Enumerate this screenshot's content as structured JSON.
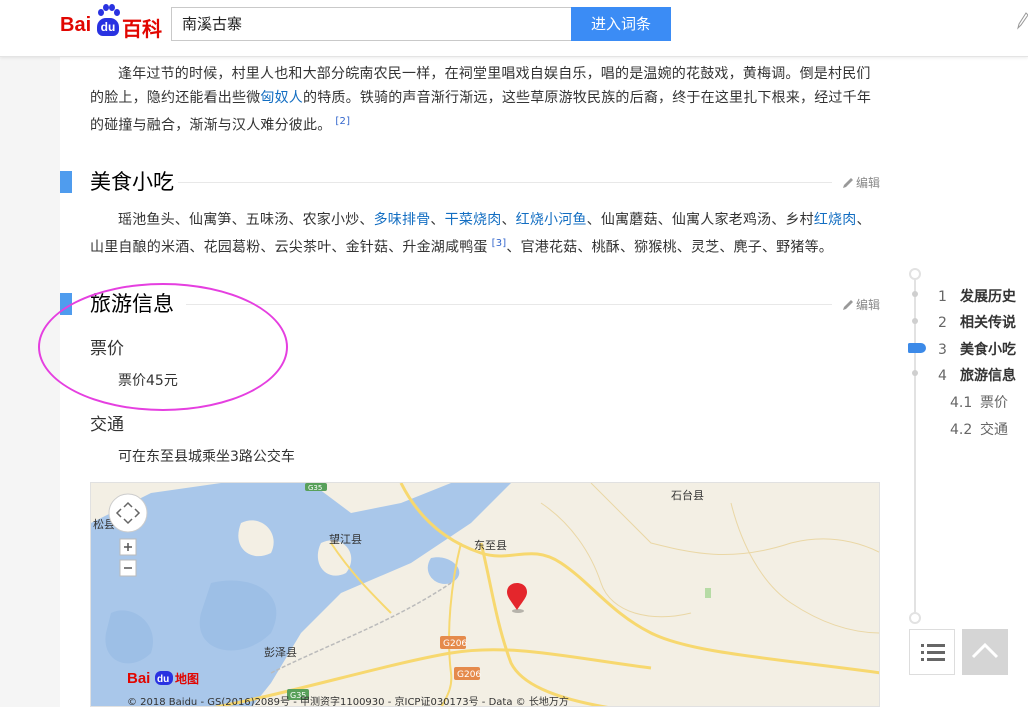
{
  "header": {
    "logo_bai": "Bai",
    "logo_du": "du",
    "logo_baike": "百科",
    "search_value": "南溪古寨",
    "search_button": "进入词条"
  },
  "intro": {
    "part1": "逢年过节的时候，村里人也和大部分皖南农民一样，在祠堂里唱戏自娱自乐，唱的是温婉的花鼓戏，黄梅调。倒是村民们的脸上，隐约还能看出些微",
    "link": "匈奴人",
    "part2": "的特质。铁骑的声音渐行渐远，这些草原游牧民族的后裔，终于在这里扎下根来，经过千年的碰撞与融合，渐渐与汉人难分彼此。",
    "ref": "[2]"
  },
  "food": {
    "title": "美食小吃",
    "edit": "编辑",
    "t1": "瑶池鱼头、仙寓笋、五味汤、农家小炒、",
    "l1": "多味排骨",
    "s1": "、",
    "l2": "干菜烧肉",
    "s2": "、",
    "l3": "红烧小河鱼",
    "t2": "、仙寓蘑菇、仙寓人家老鸡汤、乡村",
    "l4": "红烧肉",
    "t3": "、山里自酿的米酒、花园葛粉、云尖茶叶、金针菇、升金湖咸鸭蛋",
    "ref": "[3]",
    "t4": "、官港花菇、桃酥、猕猴桃、灵芝、麂子、野猪等。"
  },
  "travel": {
    "title": "旅游信息",
    "edit": "编辑",
    "ticket_title": "票价",
    "ticket_text": "票价45元",
    "traffic_title": "交通",
    "traffic_text": "可在东至县城乘坐3路公交车"
  },
  "map": {
    "labels": {
      "shitai": "石台县",
      "wangjiang": "望江县",
      "dongzhi": "东至县",
      "pengze": "彭泽县",
      "song": "松县"
    },
    "road1": "G206",
    "road2": "G206",
    "road3": "G35",
    "road4": "G35",
    "logo": "地图",
    "logo_bai": "Bai",
    "logo_du": "du",
    "copyright": "© 2018 Baidu - GS(2016)2089号 - 甲测资字1100930 - 京ICP证030173号 - Data © 长地万方"
  },
  "toc": {
    "items": [
      {
        "num": "1",
        "text": "发展历史"
      },
      {
        "num": "2",
        "text": "相关传说"
      },
      {
        "num": "3",
        "text": "美食小吃"
      },
      {
        "num": "4",
        "text": "旅游信息"
      },
      {
        "num": "4.1",
        "text": "票价"
      },
      {
        "num": "4.2",
        "text": "交通"
      }
    ],
    "active_index": 2
  },
  "colors": {
    "accent": "#4f9cee",
    "link": "#136ec2",
    "brand_red": "#e10601",
    "brand_blue": "#2932e1",
    "annotation": "#e53fe0"
  }
}
